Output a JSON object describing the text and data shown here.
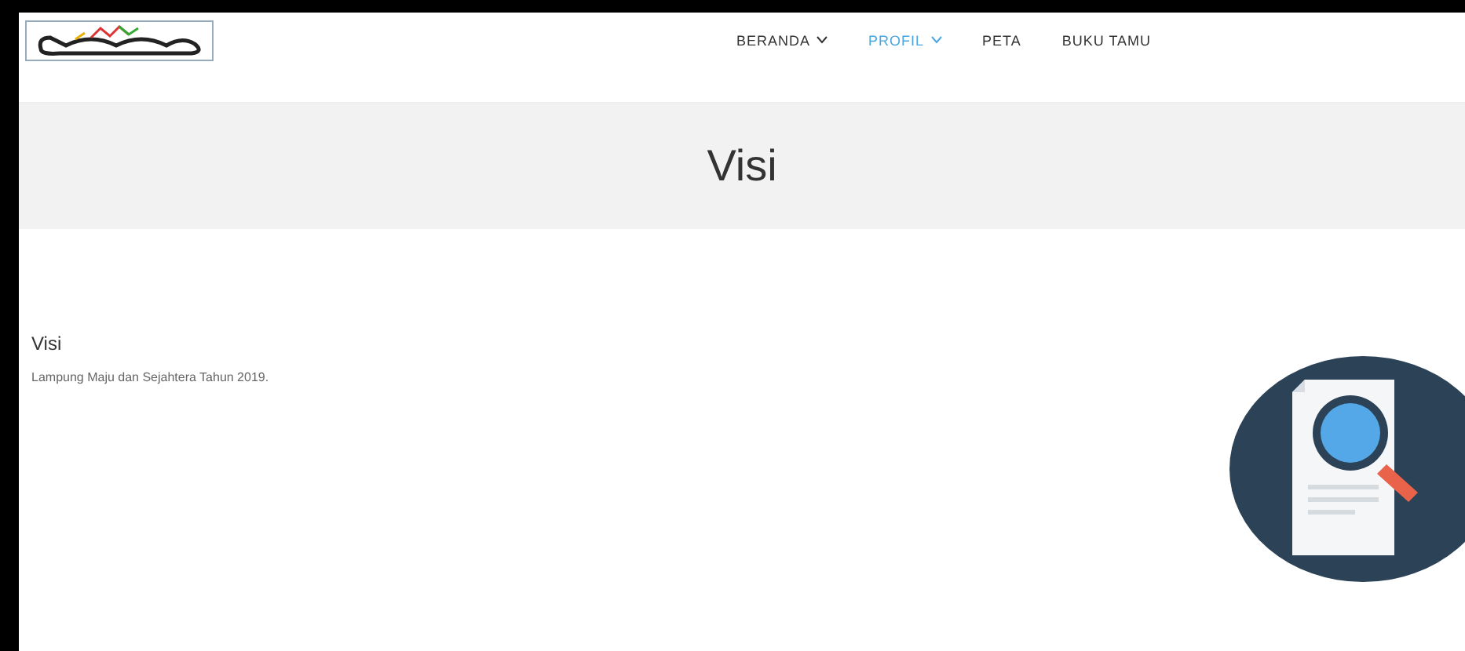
{
  "nav": [
    {
      "label": "BERANDA",
      "dropdown": true,
      "selected": false
    },
    {
      "label": "PROFIL",
      "dropdown": true,
      "selected": true
    },
    {
      "label": "PETA",
      "dropdown": false,
      "selected": false
    },
    {
      "label": "BUKU TAMU",
      "dropdown": false,
      "selected": false
    }
  ],
  "banner": {
    "title": "Visi"
  },
  "content": {
    "heading": "Visi",
    "text": "Lampung Maju dan Sejahtera Tahun 2019."
  }
}
